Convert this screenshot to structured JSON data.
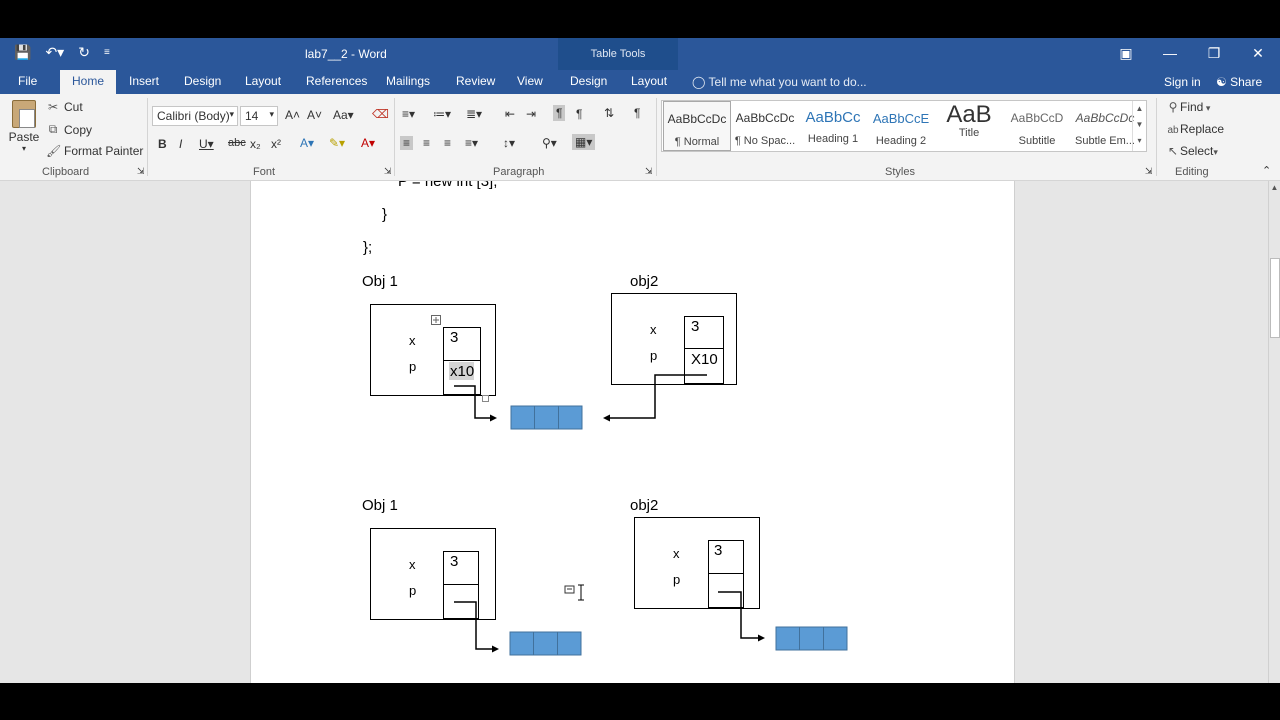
{
  "window": {
    "doc_title": "lab7__2  -  Word",
    "context_tab_label": "Table Tools"
  },
  "tabs": {
    "file": "File",
    "home": "Home",
    "insert": "Insert",
    "design": "Design",
    "layout": "Layout",
    "references": "References",
    "mailings": "Mailings",
    "review": "Review",
    "view": "View",
    "table_design": "Design",
    "table_layout": "Layout",
    "tell_me": "Tell me what you want to do...",
    "sign_in": "Sign in",
    "share": "Share"
  },
  "clipboard": {
    "paste": "Paste",
    "cut": "Cut",
    "copy": "Copy",
    "format_painter": "Format Painter",
    "label": "Clipboard"
  },
  "font": {
    "family": "Calibri (Body)",
    "size": "14",
    "label": "Font"
  },
  "paragraph": {
    "label": "Paragraph"
  },
  "styles": {
    "label": "Styles",
    "items": [
      {
        "sample": "AaBbCcDc",
        "name": "¶ Normal"
      },
      {
        "sample": "AaBbCcDc",
        "name": "¶ No Spac..."
      },
      {
        "sample": "AaBbCc",
        "name": "Heading 1"
      },
      {
        "sample": "AaBbCcE",
        "name": "Heading 2"
      },
      {
        "sample": "AaB",
        "name": "Title"
      },
      {
        "sample": "AaBbCcD",
        "name": "Subtitle"
      },
      {
        "sample": "AaBbCcDc",
        "name": "Subtle Em..."
      }
    ]
  },
  "editing": {
    "find": "Find",
    "replace": "Replace",
    "select": "Select",
    "label": "Editing"
  },
  "document": {
    "code_line1": "P = new int [3];",
    "code_line2": "}",
    "code_line3": "};",
    "diagram1": {
      "obj1_label": "Obj 1",
      "obj2_label": "obj2",
      "x_label": "x",
      "p_label": "p",
      "obj1_x_value": "3",
      "obj1_p_value": "x10",
      "obj2_x_value": "3",
      "obj2_p_value": "X10"
    },
    "diagram2": {
      "obj1_label": "Obj 1",
      "obj2_label": "obj2",
      "x_label": "x",
      "p_label": "p",
      "obj1_x_value": "3",
      "obj2_x_value": "3"
    }
  },
  "colors": {
    "titlebar": "#2b579a",
    "array_cell": "#5b9bd5"
  }
}
